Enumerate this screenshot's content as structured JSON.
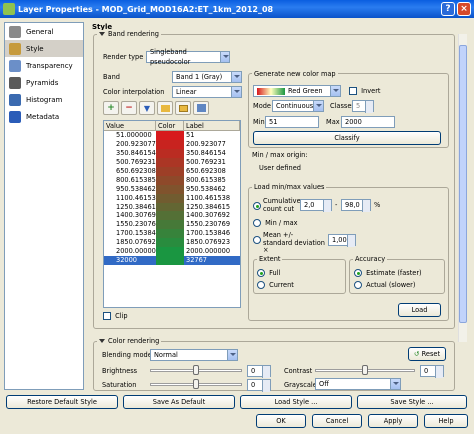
{
  "window": {
    "title": "Layer Properties - MOD_Grid_MOD16A2:ET_1km_2012_08",
    "help": "?",
    "close": "×"
  },
  "sidebar": {
    "items": [
      {
        "label": "General",
        "icon": "tools-icon",
        "color": "#8a8a8a"
      },
      {
        "label": "Style",
        "icon": "palette-icon",
        "color": "#c69a3c"
      },
      {
        "label": "Transparency",
        "icon": "transparency-icon",
        "color": "#6b8fc8"
      },
      {
        "label": "Pyramids",
        "icon": "pyramid-icon",
        "color": "#5a5a5a"
      },
      {
        "label": "Histogram",
        "icon": "histogram-icon",
        "color": "#3a6ab0"
      },
      {
        "label": "Metadata",
        "icon": "info-icon",
        "color": "#2a5cb8"
      }
    ]
  },
  "style": {
    "heading": "Style",
    "band_rendering": {
      "title": "Band rendering",
      "render_type_label": "Render type",
      "render_type": "Singleband pseudocolor",
      "band_label": "Band",
      "band": "Band 1 (Gray)",
      "interp_label": "Color interpolation",
      "interp": "Linear",
      "columns": [
        "Value",
        "Color",
        "Label"
      ],
      "rows": [
        {
          "value": "51.000000",
          "label": "51"
        },
        {
          "value": "200.923077",
          "label": "200.923077"
        },
        {
          "value": "350.846154",
          "label": "350.846154"
        },
        {
          "value": "500.769231",
          "label": "500.769231"
        },
        {
          "value": "650.692308",
          "label": "650.692308"
        },
        {
          "value": "800.615385",
          "label": "800.615385"
        },
        {
          "value": "950.538462",
          "label": "950.538462"
        },
        {
          "value": "1100.461538",
          "label": "1100.461538"
        },
        {
          "value": "1250.384615",
          "label": "1250.384615"
        },
        {
          "value": "1400.307692",
          "label": "1400.307692"
        },
        {
          "value": "1550.230769",
          "label": "1550.230769"
        },
        {
          "value": "1700.153846",
          "label": "1700.153846"
        },
        {
          "value": "1850.076923",
          "label": "1850.076923"
        },
        {
          "value": "2000.000000",
          "label": "2000.000000"
        },
        {
          "value": "32000",
          "label": "32767"
        }
      ],
      "clip_label": "Clip",
      "new_color_map": {
        "title": "Generate new color map",
        "ramp": "Red Green",
        "invert_label": "Invert",
        "mode_label": "Mode",
        "mode": "Continuous",
        "classes_label": "Classes",
        "classes": "5",
        "min_label": "Min",
        "min": "51",
        "max_label": "Max",
        "max": "2000",
        "classify": "Classify"
      },
      "minmax_origin_label": "Min / max origin:",
      "minmax_origin_value": "User defined",
      "load_minmax": {
        "title": "Load min/max values",
        "cumulative_label": "Cumulative\ncount cut",
        "cut_low": "2,0",
        "cut_high": "98,0",
        "dash": "-",
        "pct": "%",
        "minmax_label": "Min / max",
        "mean_label": "Mean +/-\nstandard deviation ×",
        "std": "1,00",
        "extent_title": "Extent",
        "full": "Full",
        "current": "Current",
        "accuracy_title": "Accuracy",
        "estimate": "Estimate (faster)",
        "actual": "Actual (slower)",
        "load": "Load"
      }
    },
    "color_rendering": {
      "title": "Color rendering",
      "blending_label": "Blending mode",
      "blending": "Normal",
      "reset": "Reset",
      "brightness_label": "Brightness",
      "brightness": "0",
      "contrast_label": "Contrast",
      "contrast": "0",
      "saturation_label": "Saturation",
      "saturation": "0",
      "grayscale_label": "Grayscale",
      "grayscale": "Off",
      "brightness_level": 0.5,
      "contrast_level": 0.5,
      "saturation_level": 0.5
    }
  },
  "footer": {
    "restore": "Restore Default Style",
    "save_default": "Save As Default",
    "load_style": "Load Style ...",
    "save_style": "Save Style ...",
    "ok": "OK",
    "cancel": "Cancel",
    "apply": "Apply",
    "help": "Help"
  },
  "colors": {
    "ramp_start": "#d7191c",
    "ramp_end": "#1a9641",
    "selection": "#316ac5"
  }
}
